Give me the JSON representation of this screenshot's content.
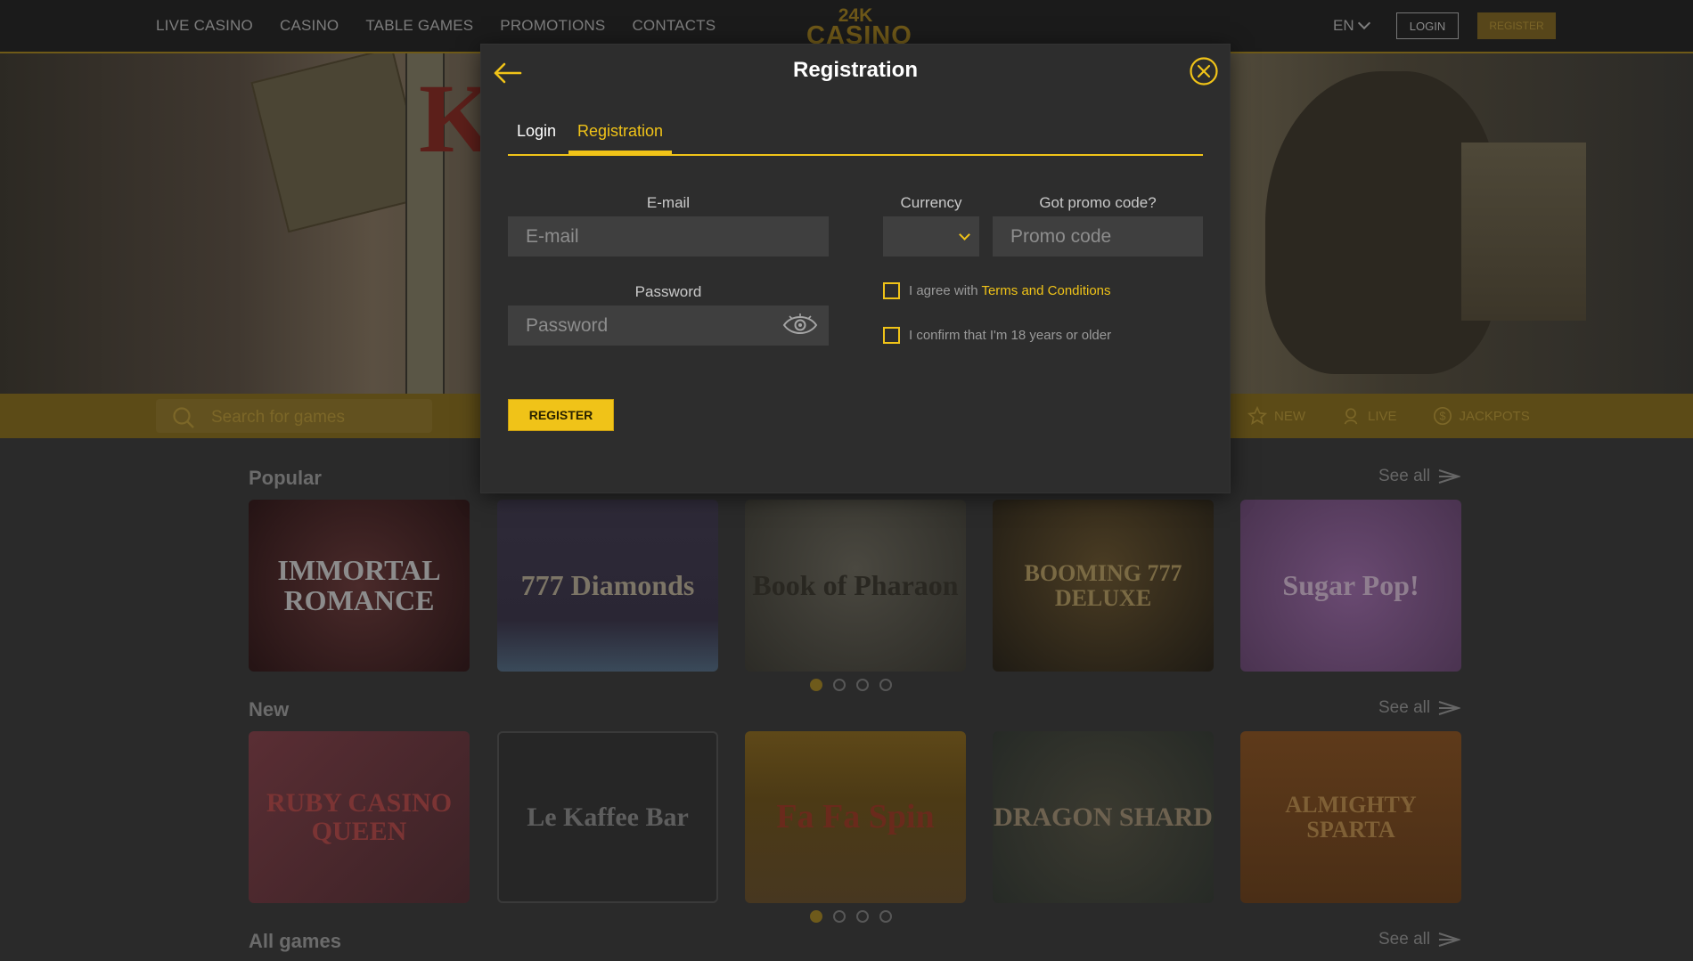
{
  "header": {
    "nav": [
      "LIVE CASINO",
      "CASINO",
      "TABLE GAMES",
      "PROMOTIONS",
      "CONTACTS"
    ],
    "logo_top": "24K",
    "logo_bottom": "CASINO",
    "language": "EN",
    "login": "LOGIN",
    "register": "REGISTER"
  },
  "search": {
    "placeholder": "Search for games",
    "filters": [
      {
        "label": "NEW",
        "icon": "star-icon"
      },
      {
        "label": "LIVE",
        "icon": "live-dealer-icon"
      },
      {
        "label": "JACKPOTS",
        "icon": "dollar-coin-icon"
      }
    ]
  },
  "sections": {
    "popular": {
      "title": "Popular",
      "see_all": "See all",
      "games": [
        "IMMORTAL ROMANCE",
        "777 Diamonds",
        "Book of Pharaon",
        "BOOMING 777 DELUXE",
        "Sugar Pop!"
      ]
    },
    "new": {
      "title": "New",
      "see_all": "See all",
      "games": [
        "RUBY CASINO QUEEN",
        "Le Kaffee Bar",
        "Fa Fa Spin",
        "DRAGON SHARD",
        "ALMIGHTY SPARTA"
      ]
    },
    "all": {
      "title": "All games",
      "see_all": "See all"
    }
  },
  "modal": {
    "title": "Registration",
    "tabs": {
      "login": "Login",
      "registration": "Registration"
    },
    "email_label": "E-mail",
    "email_placeholder": "E-mail",
    "password_label": "Password",
    "password_placeholder": "Password",
    "currency_label": "Currency",
    "currency_value": "",
    "promo_label": "Got promo code?",
    "promo_placeholder": "Promo code",
    "agree_text": "I agree with ",
    "terms_link": "Terms and Conditions",
    "age_text": "I confirm that I'm 18 years or older",
    "register_button": "REGISTER"
  },
  "colors": {
    "accent": "#f0c318",
    "background": "#2a2a2a",
    "modal_bg": "#2d2d2d",
    "input_bg": "#3f3f3f"
  }
}
